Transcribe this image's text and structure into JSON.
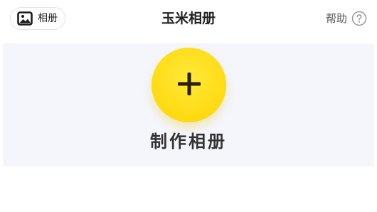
{
  "header": {
    "album_button_label": "相册",
    "album_icon": "image-icon",
    "title": "玉米相册",
    "help_label": "帮助",
    "help_icon": "question-circle-icon"
  },
  "main": {
    "create_icon": "plus-icon",
    "create_label": "制作相册"
  },
  "colors": {
    "accent_yellow": "#ffdd1a",
    "panel_background": "#f4f6fc",
    "text_dark": "#333333"
  }
}
